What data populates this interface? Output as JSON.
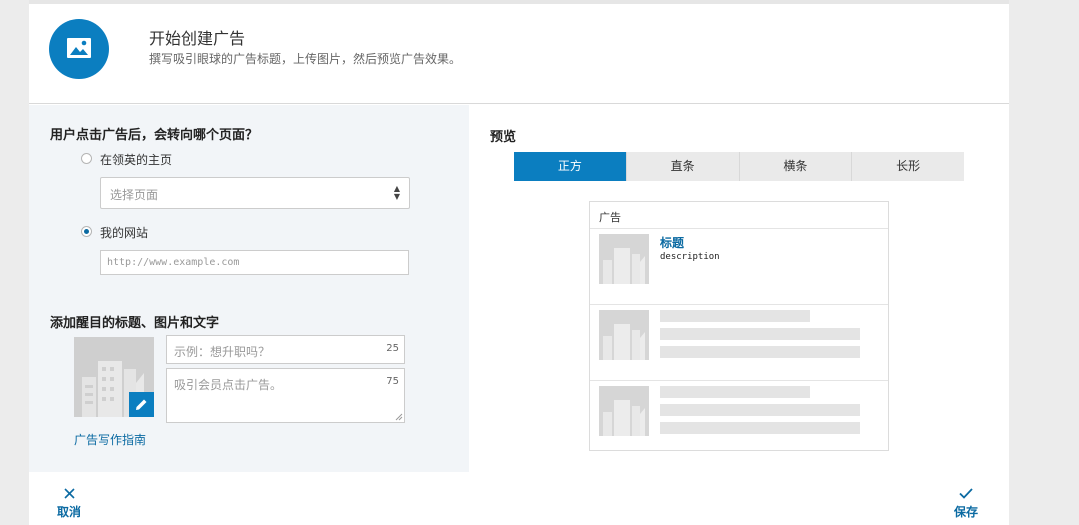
{
  "header": {
    "title": "开始创建广告",
    "subtitle": "撰写吸引眼球的广告标题，上传图片，然后预览广告效果。",
    "icon": "image-icon"
  },
  "destination": {
    "question": "用户点击广告后，会转向哪个页面？",
    "options": [
      {
        "label": "在领英的主页",
        "checked": false
      },
      {
        "label": "我的网站",
        "checked": true
      }
    ],
    "select_placeholder": "选择页面",
    "url_placeholder": "http://www.example.com"
  },
  "content": {
    "heading": "添加醒目的标题、图片和文字",
    "title_placeholder": "示例：想升职吗？",
    "title_count": "25",
    "desc_placeholder": "吸引会员点击广告。",
    "desc_count": "75",
    "guide_link": "广告写作指南"
  },
  "preview": {
    "heading": "预览",
    "tabs": [
      {
        "label": "正方",
        "active": true
      },
      {
        "label": "直条",
        "active": false
      },
      {
        "label": "横条",
        "active": false
      },
      {
        "label": "长形",
        "active": false
      }
    ],
    "card_label": "广告",
    "ad_title": "标题",
    "ad_description": "description"
  },
  "footer": {
    "cancel_label": "取消",
    "save_label": "保存"
  },
  "colors": {
    "accent": "#0b7ec0",
    "link": "#0b6aa2",
    "pane_bg": "#f2f5f8",
    "tab_bg": "#eaeaea",
    "placeholder": "#e4e4e4"
  }
}
